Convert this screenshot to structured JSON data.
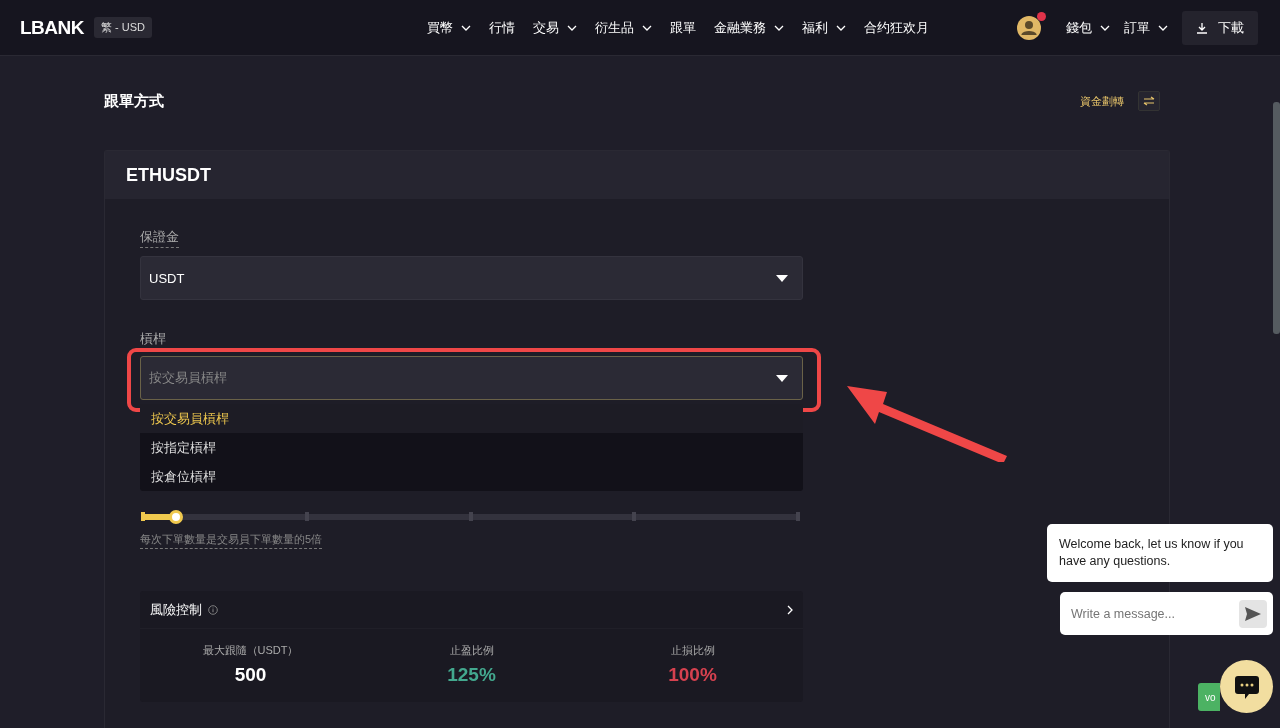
{
  "header": {
    "logo": "LBANK",
    "locale": "繁 - USD",
    "nav": [
      {
        "label": "買幣",
        "has_menu": true
      },
      {
        "label": "行情",
        "has_menu": false
      },
      {
        "label": "交易",
        "has_menu": true
      },
      {
        "label": "衍生品",
        "has_menu": true
      },
      {
        "label": "跟單",
        "has_menu": false
      },
      {
        "label": "金融業務",
        "has_menu": true
      },
      {
        "label": "福利",
        "has_menu": true
      },
      {
        "label": "合约狂欢月",
        "has_menu": false
      }
    ],
    "notification": true,
    "account_menu": [
      {
        "label": "錢包"
      },
      {
        "label": "訂單"
      }
    ],
    "download": "下載"
  },
  "page": {
    "title": "跟單方式",
    "transfer_link": "資金劃轉"
  },
  "card": {
    "title": "ETHUSDT",
    "margin": {
      "label": "保證金",
      "value": "USDT"
    },
    "leverage": {
      "label": "槓桿",
      "placeholder": "按交易員槓桿",
      "expanded": true,
      "options": [
        {
          "label": "按交易員槓桿",
          "selected": true
        },
        {
          "label": "按指定槓桿",
          "selected": false
        },
        {
          "label": "按倉位槓桿",
          "selected": false
        }
      ]
    },
    "multiplier": {
      "level": 0.05,
      "note": "每次下單數量是交易員下單數量的5倍"
    },
    "risk": {
      "title": "風險控制",
      "stats": [
        {
          "label": "最大跟隨（USDT）",
          "value": "500",
          "color": "#ffffff"
        },
        {
          "label": "止盈比例",
          "value": "125%",
          "color": "#43a88e"
        },
        {
          "label": "止損比例",
          "value": "100%",
          "color": "#d5414f"
        }
      ]
    }
  },
  "chat": {
    "message": "Welcome back, let us know if you have any questions.",
    "placeholder": "Write a message..."
  },
  "green_button": "vo"
}
